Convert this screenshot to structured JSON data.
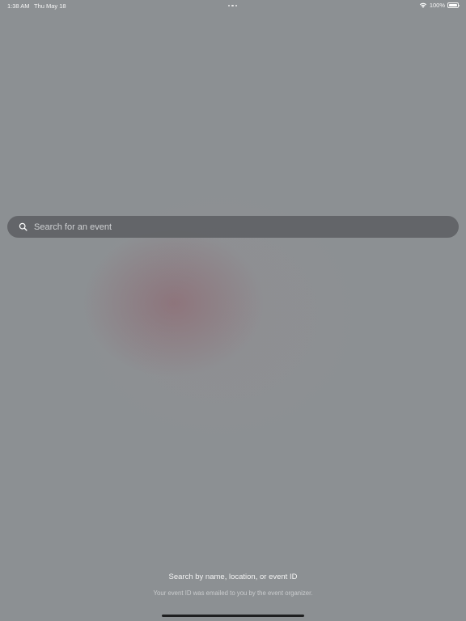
{
  "status_bar": {
    "time": "1:38 AM",
    "date": "Thu May 18",
    "battery": "100%"
  },
  "search": {
    "placeholder": "Search for an event",
    "value": ""
  },
  "hints": {
    "primary": "Search by name, location, or event ID",
    "secondary": "Your event ID was emailed to you by the event organizer."
  },
  "icons": {
    "search": "search-icon",
    "wifi": "wifi-icon",
    "battery": "battery-icon",
    "multitasking": "multitasking-dots-icon"
  },
  "colors": {
    "background": "#8c9093",
    "search_bar": "#5f6265",
    "text_primary": "#ffffff",
    "text_secondary": "#c9cbcd"
  }
}
